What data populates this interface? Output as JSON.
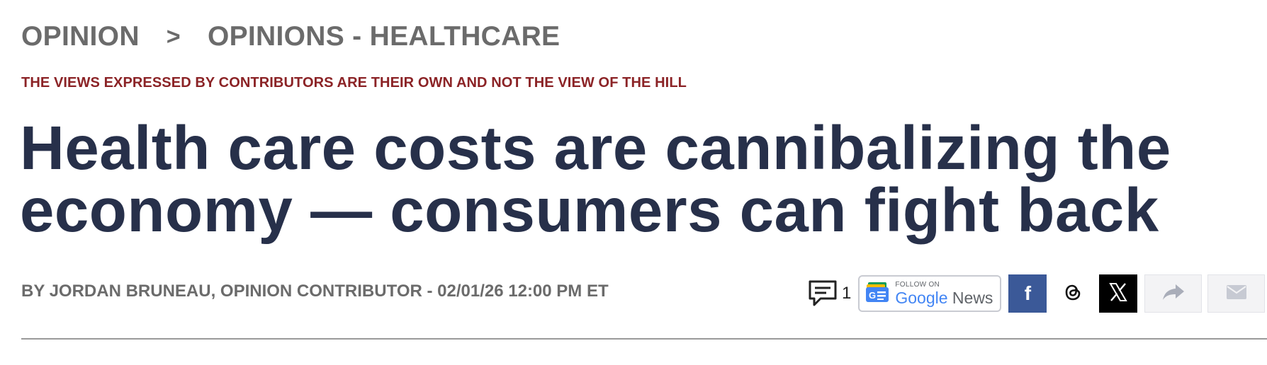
{
  "breadcrumb": {
    "section": "OPINION",
    "separator": ">",
    "subsection": "OPINIONS - HEALTHCARE"
  },
  "disclaimer": "THE VIEWS EXPRESSED BY CONTRIBUTORS ARE THEIR OWN AND NOT THE VIEW OF THE HILL",
  "headline": "Health care costs are cannibalizing the economy — consumers can fight back",
  "byline": {
    "author": "BY JORDAN BRUNEAU, OPINION CONTRIBUTOR",
    "separator": " - ",
    "datetime": "02/01/26 12:00 PM ET"
  },
  "share": {
    "comment_count": "1",
    "google_news": {
      "follow_label": "FOLLOW ON",
      "brand_google": "Google",
      "brand_news": "News"
    },
    "facebook_glyph": "f",
    "icons": [
      "comment-icon",
      "google-news-icon",
      "facebook-icon",
      "threads-icon",
      "x-icon",
      "share-arrow-icon",
      "mail-icon"
    ]
  },
  "colors": {
    "headline": "#27304a",
    "disclaimer": "#8b2326",
    "breadcrumb": "#6b6b6b",
    "facebook": "#3b5998",
    "x": "#000000"
  }
}
